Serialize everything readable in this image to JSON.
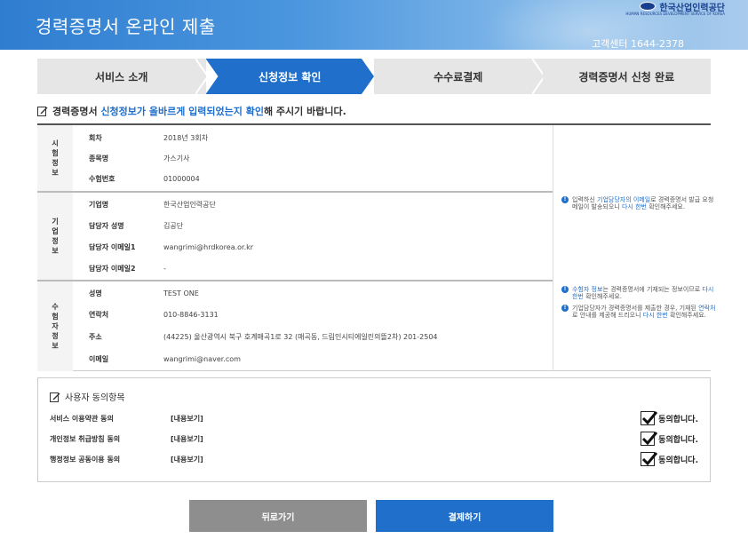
{
  "header": {
    "title": "경력증명서 온라인 제출",
    "org_name": "한국산업인력공단",
    "org_sub": "HUMAN RESOURCES DEVELOPMENT SERVICE OF KOREA",
    "customer_center": "고객센터 1644-2378"
  },
  "steps": [
    {
      "label": "서비스 소개",
      "active": false
    },
    {
      "label": "신청정보 확인",
      "active": true
    },
    {
      "label": "수수료결제",
      "active": false
    },
    {
      "label": "경력증명서 신청 완료",
      "active": false
    }
  ],
  "notice": {
    "before": "경력증명서 ",
    "highlight": "신청정보가 올바르게 입력되었는지 확인",
    "after": "해 주시기 바랍니다."
  },
  "exam_info": {
    "group_label": "시\n험\n정\n보",
    "rows": [
      {
        "key": "회차",
        "value": "2018년 3회차"
      },
      {
        "key": "종목명",
        "value": "가스기사"
      },
      {
        "key": "수험번호",
        "value": "01000004"
      }
    ]
  },
  "company_info": {
    "group_label": "기\n업\n정\n보",
    "rows": [
      {
        "key": "기업명",
        "value": "한국산업인력공단"
      },
      {
        "key": "담당자 성명",
        "value": "김공단"
      },
      {
        "key": "담당자 이메일1",
        "value": "wangrimi@hrdkorea.or.kr"
      },
      {
        "key": "담당자 이메일2",
        "value": "-"
      }
    ],
    "tip": {
      "p1": "입력하신 ",
      "h1": "기업담당자의 이메일",
      "p2": "로 경력증명서 발급 요청 메일이 발송되오니 ",
      "h2": "다시 한번",
      "p3": " 확인해주세요."
    }
  },
  "examinee_info": {
    "group_label": "수\n험\n자\n정\n보",
    "rows": [
      {
        "key": "성명",
        "value": "TEST ONE"
      },
      {
        "key": "연락처",
        "value": "010-8846-3131"
      },
      {
        "key": "주소",
        "value": "(44225) 울산광역시 북구 호계매곡1로 32 (매곡동, 드림인시티에일린의뜰2차) 201-2504"
      },
      {
        "key": "이메일",
        "value": "wangrimi@naver.com"
      }
    ],
    "tip1": {
      "h1": "수험자 정보",
      "p1": "는 경력증명서에 기재되는 정보이므로 ",
      "h2": "다시 한번",
      "p2": " 확인해주세요."
    },
    "tip2": {
      "p1": "기업담당자가 경력증명서를 제출한 경우, 기재된 ",
      "h1": "연락처",
      "p2": "로 안내를 제공해 드리오니 ",
      "h2": "다시 한번",
      "p3": " 확인해주세요."
    }
  },
  "consent": {
    "title": "사용자 동의항목",
    "rows": [
      {
        "label": "서비스 이용약관 동의",
        "link": "[내용보기]",
        "agree": "동의합니다.",
        "checked": true
      },
      {
        "label": "개인정보 취급방침 동의",
        "link": "[내용보기]",
        "agree": "동의합니다.",
        "checked": true
      },
      {
        "label": "행정정보 공동이용 동의",
        "link": "[내용보기]",
        "agree": "동의합니다.",
        "checked": true
      }
    ]
  },
  "buttons": {
    "back": "뒤로가기",
    "pay": "결제하기"
  },
  "colors": {
    "accent": "#1f6fcb",
    "back_button": "#8e8e8e",
    "step_inactive": "#e6e6e6"
  }
}
